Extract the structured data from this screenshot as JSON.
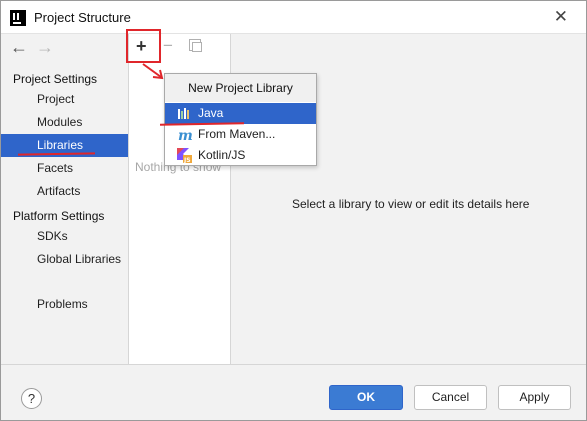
{
  "window": {
    "title": "Project Structure",
    "close_glyph": "✕"
  },
  "nav": {
    "back_glyph": "←",
    "forward_glyph": "→"
  },
  "sidebar": {
    "project_settings_header": "Project Settings",
    "project_items": [
      {
        "label": "Project"
      },
      {
        "label": "Modules"
      },
      {
        "label": "Libraries",
        "selected": true
      },
      {
        "label": "Facets"
      },
      {
        "label": "Artifacts"
      }
    ],
    "platform_settings_header": "Platform Settings",
    "platform_items": [
      {
        "label": "SDKs"
      },
      {
        "label": "Global Libraries"
      }
    ],
    "problems_item": {
      "label": "Problems"
    }
  },
  "library_list": {
    "toolbar": {
      "add_glyph": "+",
      "remove_glyph": "−"
    },
    "empty_text": "Nothing to show"
  },
  "details": {
    "placeholder": "Select a library to view or edit its details here"
  },
  "popup": {
    "title": "New Project Library",
    "items": [
      {
        "label": "Java",
        "icon": "java-library-icon",
        "selected": true
      },
      {
        "label": "From Maven...",
        "icon": "maven-icon"
      },
      {
        "label": "Kotlin/JS",
        "icon": "kotlin-js-icon"
      }
    ]
  },
  "footer": {
    "help_glyph": "?",
    "ok_label": "OK",
    "cancel_label": "Cancel",
    "apply_label": "Apply"
  },
  "colors": {
    "selection": "#2f65ca",
    "annotation": "#e0262b",
    "ok_button": "#3b7bd3"
  }
}
